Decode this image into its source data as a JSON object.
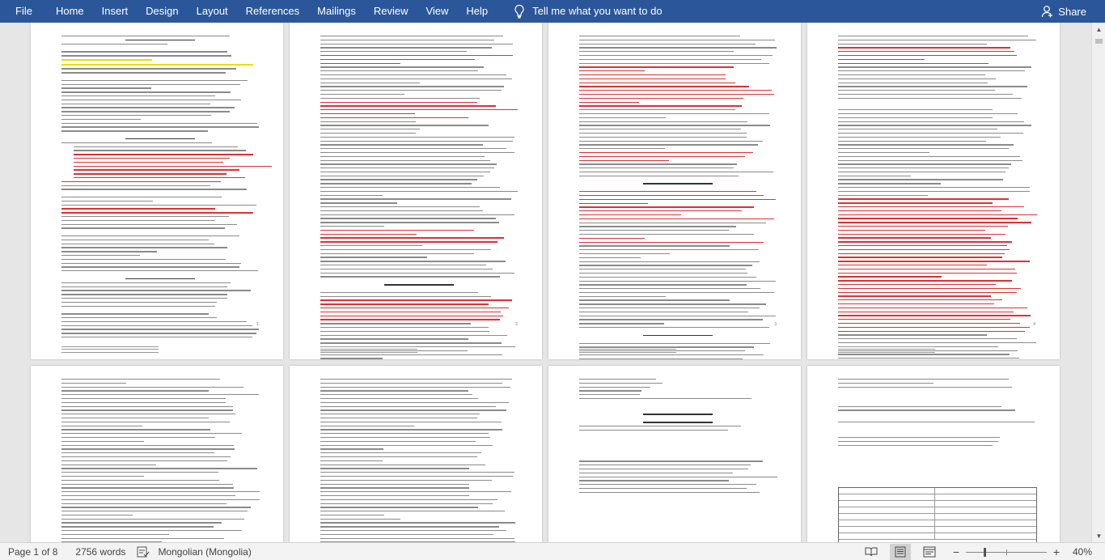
{
  "ribbon": {
    "tabs": [
      "File",
      "Home",
      "Insert",
      "Design",
      "Layout",
      "References",
      "Mailings",
      "Review",
      "View",
      "Help"
    ],
    "tell_me": "Tell me what you want to do",
    "share": "Share",
    "bg_color": "#2b579a"
  },
  "status": {
    "page": "Page 1 of 8",
    "words": "2756 words",
    "language": "Mongolian (Mongolia)",
    "zoom": "40%",
    "zoom_level_percent": 40
  },
  "pages": {
    "p1_number": "1",
    "p2_number": "2",
    "p3_number": "3",
    "p4_number": "4"
  }
}
